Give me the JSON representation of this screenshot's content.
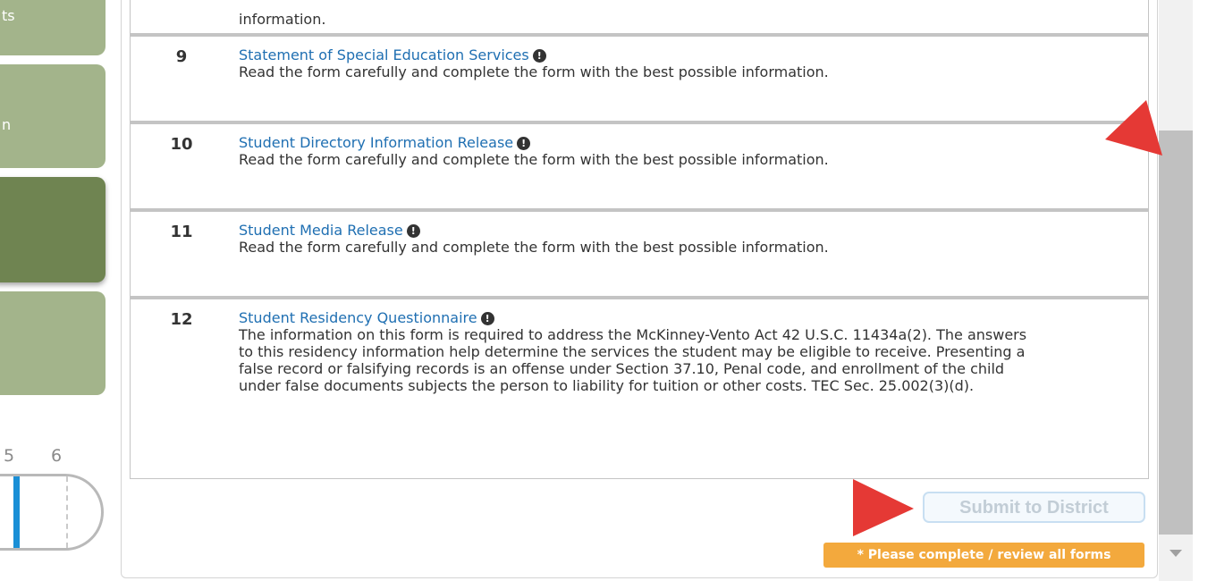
{
  "sidebar": {
    "items": [
      {
        "label": "ts"
      },
      {
        "label": "n"
      },
      {
        "label": ""
      },
      {
        "label": ""
      }
    ]
  },
  "progress": {
    "step_labels": [
      "5",
      "6"
    ]
  },
  "forms": {
    "partial_top_desc": "information.",
    "rows": [
      {
        "number": "9",
        "title": "Statement of Special Education Services",
        "description": "Read the form carefully and complete the form with the best possible information."
      },
      {
        "number": "10",
        "title": "Student Directory Information Release",
        "description": "Read the form carefully and complete the form with the best possible information."
      },
      {
        "number": "11",
        "title": "Student Media Release",
        "description": "Read the form carefully and complete the form with the best possible information."
      },
      {
        "number": "12",
        "title": "Student Residency Questionnaire",
        "description": "The information on this form is required to address the McKinney-Vento Act 42 U.S.C. 11434a(2). The answers to this residency information help determine the services the student may be eligible to receive. Presenting a false record or falsifying records is an offense under Section 37.10, Penal code, and enrollment of the child under false documents subjects the person to liability for tuition or other costs. TEC Sec. 25.002(3)(d)."
      }
    ],
    "info_icon_glyph": "!",
    "info_icon": "exclamation-circle-icon"
  },
  "actions": {
    "submit_label": "Submit to District",
    "warning_label": "* Please complete / review all forms"
  },
  "colors": {
    "link": "#1f6fb2",
    "sidebar": "#a3b48b",
    "sidebar_active": "#6f8451",
    "warning": "#f3a93d",
    "annotation_arrow": "#e53935"
  }
}
